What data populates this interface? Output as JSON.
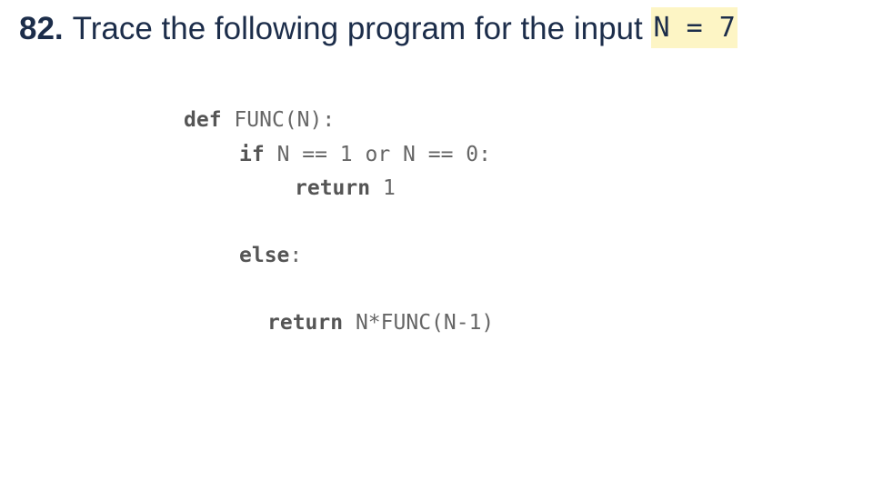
{
  "question": {
    "number": "82.",
    "text": "Trace the following program for the input",
    "input_value": "N = 7"
  },
  "code": {
    "line1": {
      "keyword": "def",
      "rest": "FUNC(N):"
    },
    "line2": {
      "keyword": "if",
      "rest": "N == 1 or N == 0:"
    },
    "line3": {
      "keyword": "return",
      "rest": "1"
    },
    "line4": {
      "keyword": "else",
      "rest": ":"
    },
    "line5": {
      "keyword": "return",
      "rest": "N*FUNC(N-1)"
    }
  }
}
